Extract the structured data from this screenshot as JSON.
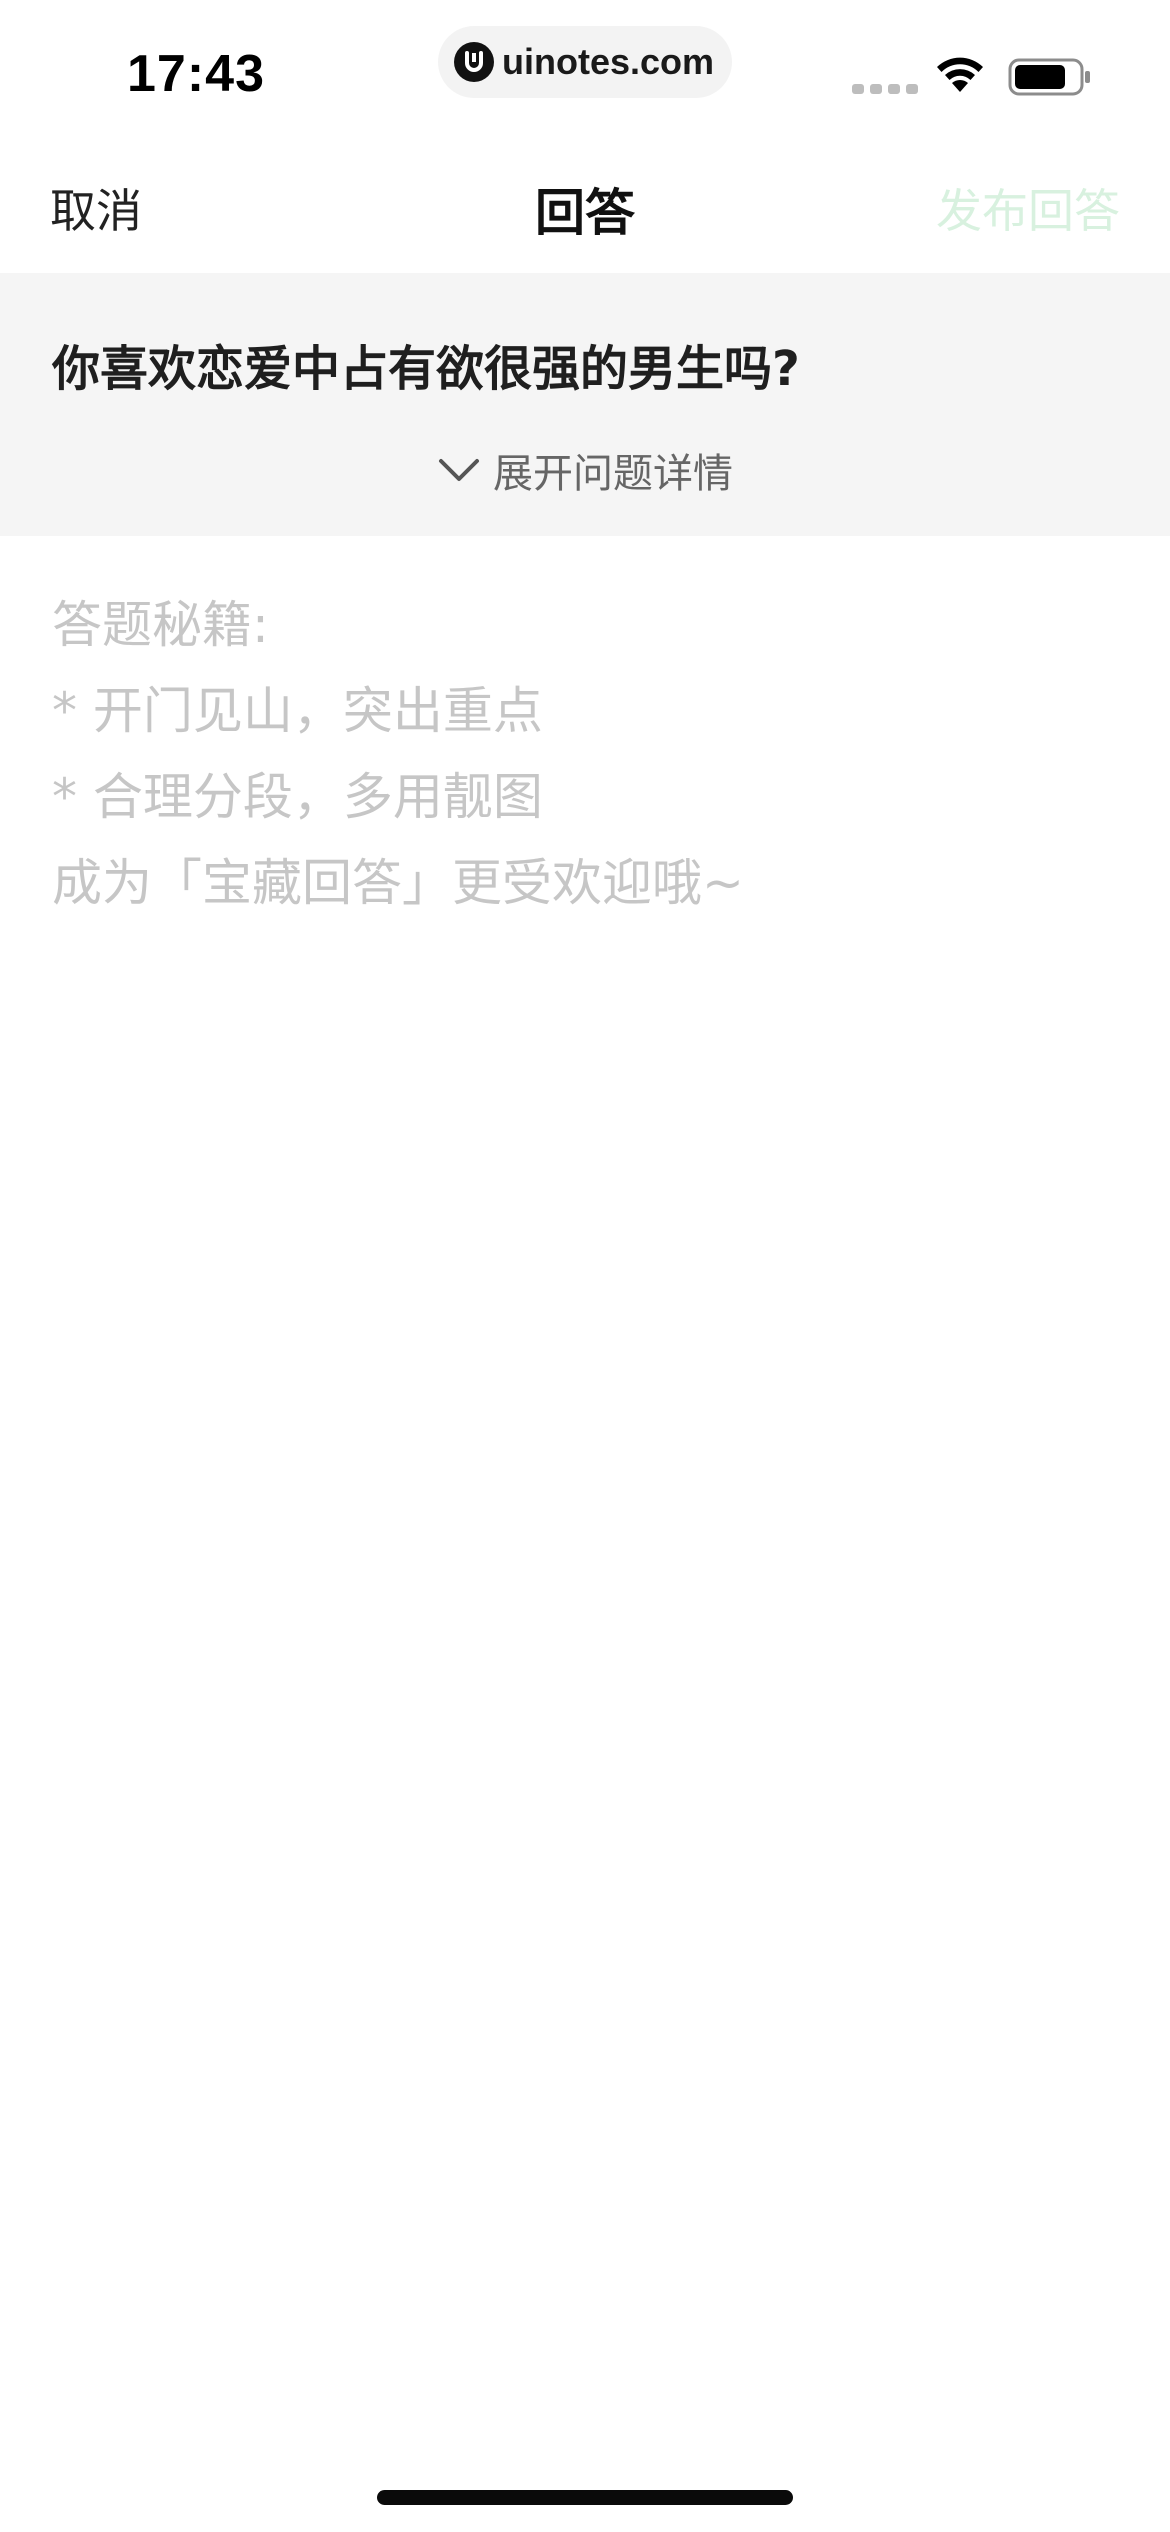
{
  "status_bar": {
    "time": "17:43",
    "url": "uinotes.com",
    "wifi_icon": "wifi-icon",
    "battery_icon": "battery-icon"
  },
  "nav": {
    "cancel_label": "取消",
    "title": "回答",
    "publish_label": "发布回答",
    "publish_color": "#d8f1df"
  },
  "question": {
    "title": "你喜欢恋爱中占有欲很强的男生吗?",
    "expand_label": "展开问题详情",
    "expand_icon": "chevron-down-icon"
  },
  "editor": {
    "placeholder_lines": [
      "答题秘籍:",
      "* 开门见山，突出重点",
      "* 合理分段，多用靓图",
      "成为「宝藏回答」更受欢迎哦~"
    ]
  }
}
